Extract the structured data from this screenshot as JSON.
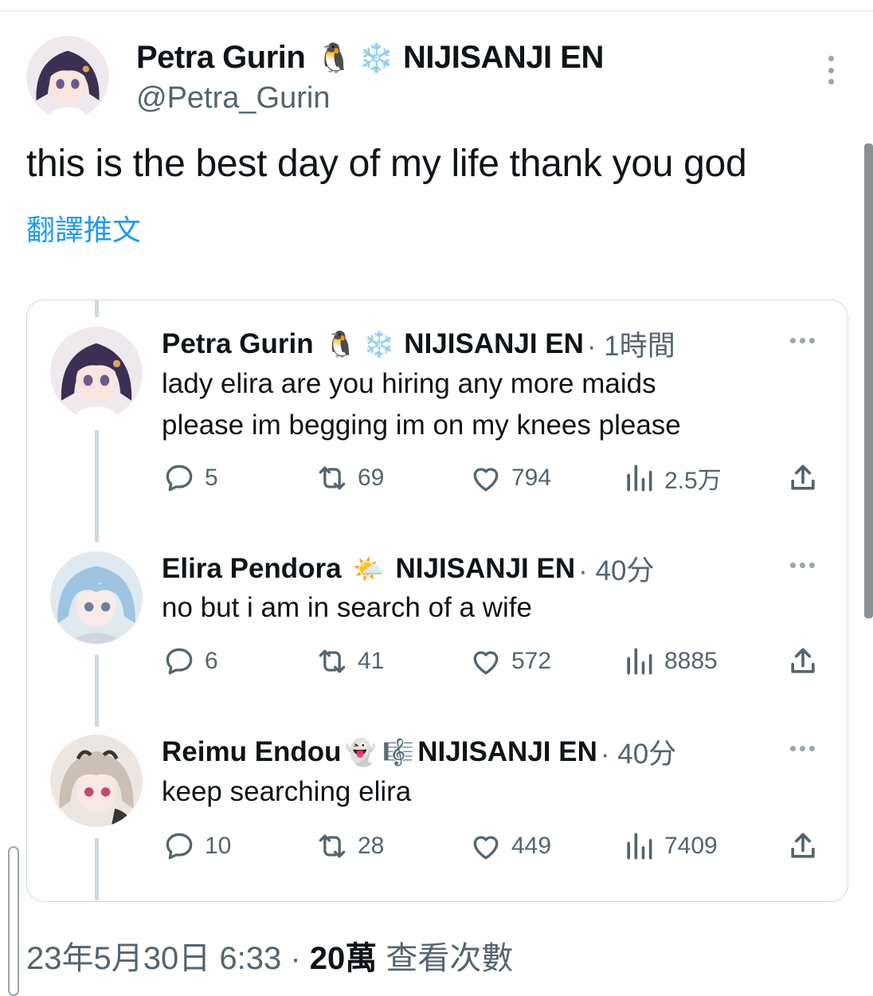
{
  "main_tweet": {
    "author_name": "Petra Gurin",
    "author_emoji_1": "🐧",
    "author_emoji_2": "❄️",
    "author_org": "NIJISANJI EN",
    "author_handle": "@Petra_Gurin",
    "text": "this is the best day of my life thank you god",
    "translate_label": "翻譯推文",
    "timestamp": "23年5月30日 6:33",
    "separator": "·",
    "views_count": "20萬",
    "views_label": "查看次數"
  },
  "thread": [
    {
      "name": "Petra Gurin",
      "emoji_1": "🐧",
      "emoji_2": "❄️",
      "org": "NIJISANJI EN",
      "time": "· 1時間",
      "text_lines": [
        "lady elira are you hiring any more maids",
        "please im begging im on my knees please"
      ],
      "replies": "5",
      "retweets": "69",
      "likes": "794",
      "views": "2.5万"
    },
    {
      "name": "Elira Pendora",
      "emoji_1": "🌤️",
      "emoji_2": "",
      "org": "NIJISANJI EN",
      "time": "· 40分",
      "text_lines": [
        "no but i am in search of a wife"
      ],
      "replies": "6",
      "retweets": "41",
      "likes": "572",
      "views": "8885"
    },
    {
      "name": "Reimu Endou",
      "emoji_1": "👻",
      "emoji_2": "🎼",
      "org": "NIJISANJI EN",
      "time": "· 40分",
      "text_lines": [
        "keep searching elira"
      ],
      "replies": "10",
      "retweets": "28",
      "likes": "449",
      "views": "7409"
    }
  ],
  "colors": {
    "text_primary": "#0f1419",
    "text_secondary": "#536471",
    "link": "#1d9bf0",
    "border": "#cfd9de"
  },
  "icons": [
    "reply-icon",
    "retweet-icon",
    "like-icon",
    "views-icon",
    "share-icon",
    "more-icon"
  ]
}
